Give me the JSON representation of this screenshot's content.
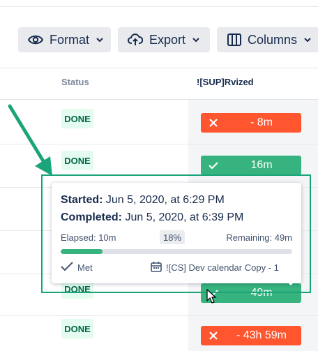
{
  "toolbar": {
    "format_label": "Format",
    "export_label": "Export",
    "columns_label": "Columns"
  },
  "table": {
    "headers": {
      "status": "Status",
      "revised": "![SUP]Rvized"
    },
    "rows": [
      {
        "status": "DONE",
        "revised": "- 8m",
        "met": false
      },
      {
        "status": "DONE",
        "revised": "16m",
        "met": true
      },
      {
        "status": "DONE",
        "revised": "49m",
        "met": true
      },
      {
        "status": "DONE",
        "revised": "- 43h 59m",
        "met": false
      }
    ]
  },
  "popup": {
    "started_label": "Started:",
    "started_value": "Jun 5, 2020, at 6:29 PM",
    "completed_label": "Completed:",
    "completed_value": "Jun 5, 2020, at 6:39 PM",
    "elapsed": "Elapsed: 10m",
    "percent": "18%",
    "progress_fraction": 0.18,
    "remaining": "Remaining: 49m",
    "met": "Met",
    "calendar": "![CS] Dev calendar Copy - 1"
  },
  "colors": {
    "done_bg": "#e3fcef",
    "done_text": "#006644",
    "breached": "#ff5630",
    "met": "#36b37e",
    "annotation": "#1ba37a"
  },
  "icons": {
    "format": "eye-icon",
    "export": "cloud-upload-icon",
    "columns": "columns-icon",
    "breached": "x-icon",
    "met": "check-icon",
    "calendar": "calendar-icon"
  }
}
